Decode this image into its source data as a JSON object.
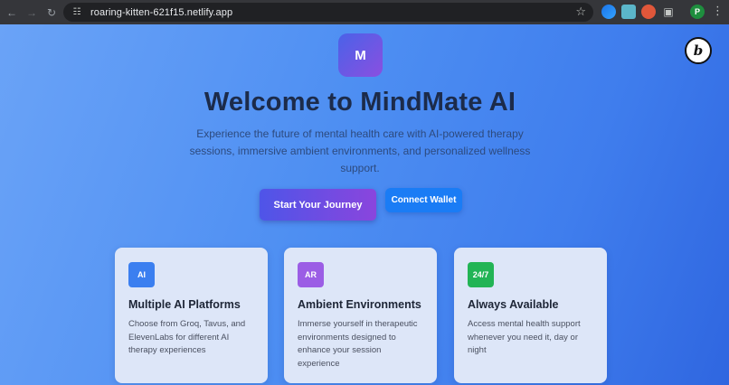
{
  "browser": {
    "url": "roaring-kitten-621f15.netlify.app",
    "profile_initial": "P",
    "icons": {
      "back": "arrow-left-icon",
      "forward": "arrow-right-icon",
      "reload": "reload-icon",
      "site_info": "tune-icon",
      "bookmark": "star-icon",
      "extensions": "puzzle-icon",
      "menu": "kebab-menu-icon"
    }
  },
  "page": {
    "logo_letter": "M",
    "corner_badge_letter": "b",
    "title": "Welcome to MindMate AI",
    "subtitle": "Experience the future of mental health care with AI-powered therapy sessions, immersive ambient environments, and personalized wellness support.",
    "primary_button": "Start Your Journey",
    "wallet_button": "Connect Wallet",
    "features": [
      {
        "badge": "AI",
        "badge_color": "#3b7ff0",
        "title": "Multiple AI Platforms",
        "description": "Choose from Groq, Tavus, and ElevenLabs for different AI therapy experiences"
      },
      {
        "badge": "AR",
        "badge_color": "#9b5de5",
        "title": "Ambient Environments",
        "description": "Immerse yourself in therapeutic environments designed to enhance your session experience"
      },
      {
        "badge": "24/7",
        "badge_color": "#22b455",
        "title": "Always Available",
        "description": "Access mental health support whenever you need it, day or night"
      }
    ]
  }
}
